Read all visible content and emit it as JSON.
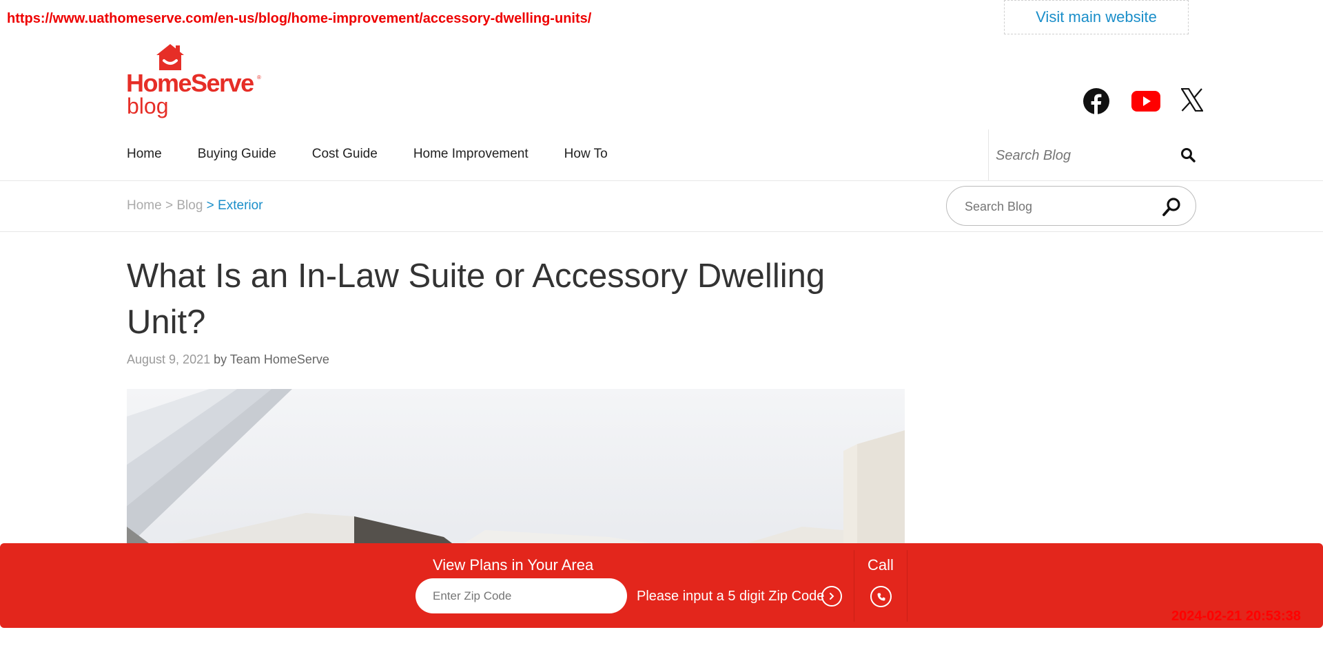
{
  "capture": {
    "url": "https://www.uathomeserve.com/en-us/blog/home-improvement/accessory-dwelling-units/",
    "timestamp": "2024-02-21 20:53:38"
  },
  "header": {
    "visit_label": "Visit main website",
    "logo_name": "HomeServe",
    "logo_sub": "blog",
    "logo_reg": "®",
    "brand_color": "#e62e27",
    "social_icons": [
      "facebook-icon",
      "youtube-icon",
      "x-icon"
    ]
  },
  "nav": {
    "items": [
      {
        "label": "Home"
      },
      {
        "label": "Buying Guide"
      },
      {
        "label": "Cost Guide"
      },
      {
        "label": "Home Improvement"
      },
      {
        "label": "How To"
      }
    ],
    "search_placeholder": "Search Blog"
  },
  "breadcrumb": {
    "home": "Home",
    "sep": ">",
    "blog": "Blog",
    "current": "> Exterior",
    "active_color": "#1a8ec9"
  },
  "sidebar_search": {
    "placeholder": "Search Blog"
  },
  "article": {
    "title": "What Is an In-Law Suite or Accessory Dwelling Unit?",
    "date": "August 9, 2021",
    "byline": "by Team HomeServe"
  },
  "cta": {
    "heading": "View Plans in Your Area",
    "zip_placeholder": "Enter Zip Code",
    "zip_message": "Please input a 5 digit Zip Code",
    "call_label": "Call",
    "bar_color": "#e3261c"
  }
}
